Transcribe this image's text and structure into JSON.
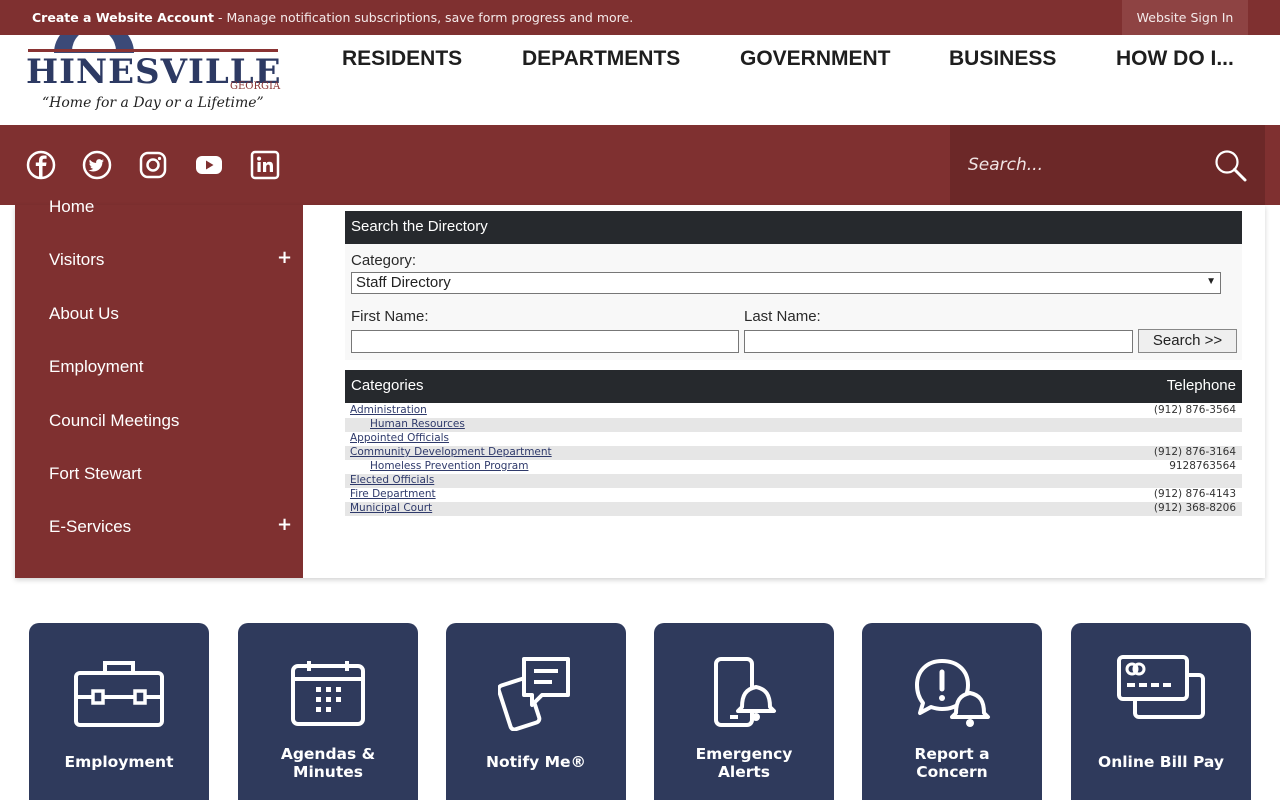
{
  "topbar": {
    "create_bold": "Create a Website Account",
    "create_rest": " - Manage notification subscriptions, save form progress and more.",
    "signin": "Website Sign In"
  },
  "logo": {
    "name": "HINESVILLE",
    "state": "GEORGIA",
    "tagline": "“Home for a Day or a Lifetime”"
  },
  "nav": {
    "items": [
      "RESIDENTS",
      "DEPARTMENTS",
      "GOVERNMENT",
      "BUSINESS",
      "HOW DO I..."
    ]
  },
  "search": {
    "placeholder": "Search..."
  },
  "sidebar": {
    "items": [
      "Home",
      "Visitors",
      "About Us",
      "Employment",
      "Council Meetings",
      "Fort Stewart",
      "E-Services"
    ]
  },
  "directory": {
    "title": "Search the Directory",
    "category_label": "Category:",
    "category_value": "Staff Directory",
    "first_label": "First Name:",
    "last_label": "Last Name:",
    "search_button": "Search >>",
    "col_categories": "Categories",
    "col_telephone": "Telephone",
    "rows": [
      {
        "name": "Administration",
        "tel": "(912) 876-3564"
      },
      {
        "name": "Human Resources",
        "tel": ""
      },
      {
        "name": "Appointed Officials",
        "tel": ""
      },
      {
        "name": "Community Development Department",
        "tel": "(912) 876-3164"
      },
      {
        "name": "Homeless Prevention Program",
        "tel": "9128763564"
      },
      {
        "name": "Elected Officials",
        "tel": ""
      },
      {
        "name": "Fire Department",
        "tel": "(912) 876-4143"
      },
      {
        "name": "Municipal Court",
        "tel": "(912) 368-8206"
      }
    ]
  },
  "tiles": {
    "items": [
      "Employment",
      "Agendas &\nMinutes",
      "Notify Me®",
      "Emergency\nAlerts",
      "Report a\nConcern",
      "Online Bill Pay"
    ]
  },
  "icons": {
    "social": [
      "facebook-icon",
      "twitter-icon",
      "instagram-icon",
      "youtube-icon",
      "linkedin-icon"
    ],
    "tiles": [
      "briefcase-icon",
      "calendar-icon",
      "chat-phone-icon",
      "phone-bell-icon",
      "alert-bell-icon",
      "credit-card-icon"
    ]
  },
  "colors": {
    "brand_red": "#7f3030",
    "navy": "#2f3a5c",
    "dark_header": "#26292d"
  }
}
